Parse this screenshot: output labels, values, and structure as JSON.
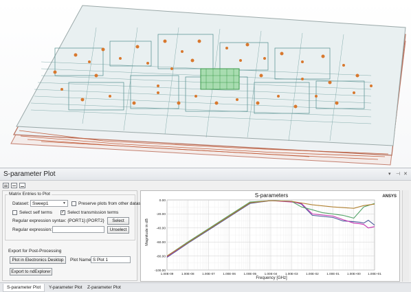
{
  "panel": {
    "title": "S-parameter Plot",
    "controls": {
      "menu": "▾",
      "pin": "⊣",
      "close": "✕"
    }
  },
  "toolbar": {
    "icons": [
      "table-icon",
      "filter-icon",
      "pin-icon"
    ]
  },
  "matrix": {
    "group_label": "Matrix Entries to Plot",
    "dataset_label": "Dataset:",
    "dataset_value": "Sweep1",
    "preserve_label": "Preserve plots from other datasets",
    "preserve_checked": false,
    "self_terms_label": "Select self terms",
    "self_terms_checked": false,
    "transmission_label": "Select transmission terms",
    "transmission_checked": true,
    "regex_syntax_label": "Regular expression syntax: {PORT1}:{PORT2}",
    "select_button": "Select",
    "regex_label": "Regular expression:",
    "regex_value": "",
    "unselect_button": "Unselect"
  },
  "export": {
    "group_label": "Export for Post-Processing",
    "plot_button": "Plot in Electronics Desktop",
    "plot_name_label": "Plot Name:",
    "plot_name_value": "S Plot 1",
    "nd_button": "Export to ndExplorer"
  },
  "tabs": [
    {
      "label": "S-parameter Plot",
      "active": true
    },
    {
      "label": "Y-parameter Plot",
      "active": false
    },
    {
      "label": "Z-parameter Plot",
      "active": false
    }
  ],
  "colors": {
    "accent": "#2a6fb3",
    "grid": "#d8d8d8",
    "viewport_trace_orange": "#d8782e",
    "viewport_trace_teal": "#4f8c8c",
    "viewport_board_red": "#c2603f"
  },
  "chart_data": {
    "type": "line",
    "title": "S-parameters",
    "brand": "ANSYS",
    "xlabel": "Frequency [GHz]",
    "ylabel": "Magnitude in dB",
    "x_scale": "log",
    "xlim": [
      1e-09,
      10
    ],
    "ylim": [
      -100,
      0
    ],
    "x_ticks": [
      "1.00E-09",
      "1.00E-08",
      "1.00E-07",
      "1.00E-06",
      "1.00E-05",
      "1.00E-04",
      "1.00E-03",
      "1.00E-02",
      "1.00E-01",
      "1.00E+00",
      "1.00E+01"
    ],
    "y_ticks": [
      "0.00",
      "-20.00",
      "-40.00",
      "-60.00",
      "-80.00",
      "-100.00"
    ],
    "y_tick_values": [
      0,
      -20,
      -40,
      -60,
      -80,
      -100
    ],
    "grid": true,
    "series": [
      {
        "color": "#4a5a9a",
        "x": [
          1e-09,
          1e-08,
          1e-07,
          1e-06,
          1e-05,
          0.0001,
          0.001,
          0.003,
          0.01,
          0.1,
          0.3,
          1,
          2,
          3,
          5,
          10
        ],
        "y": [
          -82,
          -62,
          -43,
          -24,
          -5,
          -1,
          -2,
          -6,
          -22,
          -25,
          -30,
          -31,
          -32,
          -33,
          -29,
          -36
        ]
      },
      {
        "color": "#c62fb0",
        "x": [
          1e-09,
          1e-08,
          1e-07,
          1e-06,
          1e-05,
          0.0001,
          0.001,
          0.003,
          0.01,
          0.1,
          0.3,
          1,
          2,
          3,
          5,
          10
        ],
        "y": [
          -81,
          -61,
          -42,
          -23,
          -4,
          -1,
          -3,
          -5,
          -20,
          -23,
          -28,
          -33,
          -34,
          -35,
          -40,
          -38
        ]
      },
      {
        "color": "#56a46a",
        "x": [
          1e-09,
          1e-08,
          1e-07,
          1e-06,
          1e-05,
          0.0001,
          0.001,
          0.003,
          0.01,
          0.03,
          0.1,
          0.3,
          1,
          3,
          10
        ],
        "y": [
          -80,
          -60,
          -41,
          -22,
          -3,
          -1,
          -2,
          -10,
          -14,
          -18,
          -20,
          -22,
          -26,
          -10,
          -5
        ]
      },
      {
        "color": "#b08030",
        "x": [
          1e-09,
          1e-08,
          1e-07,
          1e-06,
          1e-05,
          0.0001,
          0.001,
          0.01,
          0.1,
          1,
          3,
          10
        ],
        "y": [
          -80,
          -61,
          -42,
          -23,
          -4,
          -1,
          -2,
          -7,
          -10,
          -12,
          -8,
          -6
        ]
      }
    ]
  }
}
